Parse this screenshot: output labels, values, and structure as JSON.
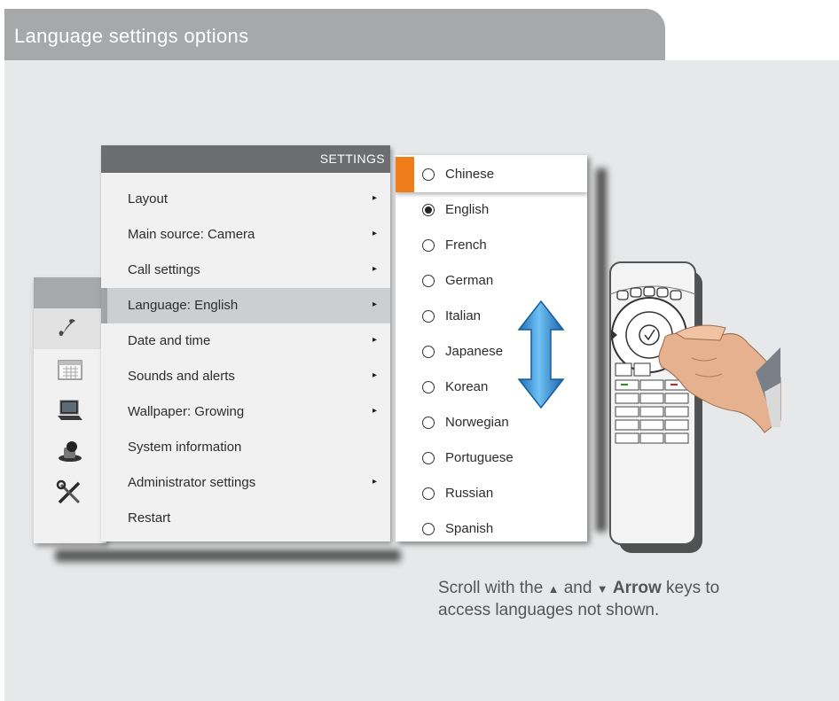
{
  "header": {
    "title": "Language settings options"
  },
  "settings_menu": {
    "title": "SETTINGS",
    "items": [
      {
        "label": "Layout",
        "arrow": "▸"
      },
      {
        "label": "Main source: Camera",
        "arrow": "▸"
      },
      {
        "label": "Call settings",
        "arrow": "▸"
      },
      {
        "label": "Language: English",
        "arrow": "▸"
      },
      {
        "label": "Date and time",
        "arrow": "▸"
      },
      {
        "label": "Sounds and alerts",
        "arrow": "▸"
      },
      {
        "label": "Wallpaper: Growing",
        "arrow": "▸"
      },
      {
        "label": "System information",
        "arrow": ""
      },
      {
        "label": "Administrator settings",
        "arrow": "▸"
      },
      {
        "label": "Restart",
        "arrow": ""
      }
    ],
    "selected_index": 3
  },
  "language_list": {
    "items": [
      "Chinese",
      "English",
      "French",
      "German",
      "Italian",
      "Japanese",
      "Korean",
      "Norwegian",
      "Portuguese",
      "Russian",
      "Spanish"
    ],
    "highlighted_index": 0,
    "checked_index": 1
  },
  "icon_bar": {
    "icons": [
      "phone-icon",
      "calendar-icon",
      "laptop-icon",
      "camera-icon",
      "tools-icon"
    ],
    "selected_index": 0
  },
  "caption": {
    "text_1": "Scroll with the",
    "up_arrow": "▲",
    "and": "and",
    "down_arrow": "▼",
    "bold": "Arrow",
    "text_2": "keys to access languages not shown."
  },
  "colors": {
    "accent": "#ee7d1a",
    "arrow_blue": "#2f8fd6",
    "header_gray": "#a7a8aa",
    "panel_bg": "#e7e8e9"
  }
}
